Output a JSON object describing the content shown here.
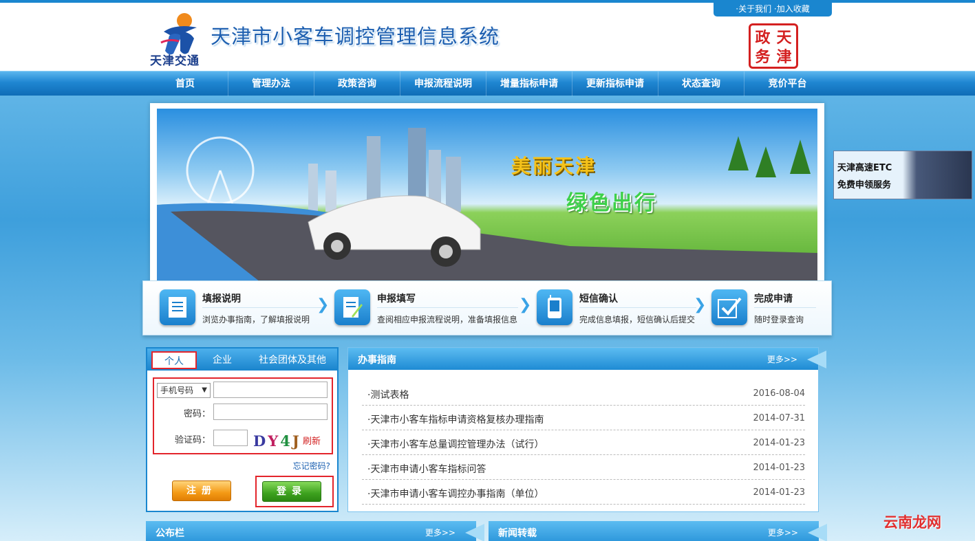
{
  "header": {
    "logo_text": "天津交通",
    "site_title": "天津市小客车调控管理信息系统",
    "top_links": [
      "·关于我们",
      "·加入收藏"
    ],
    "seal_chars": [
      "政",
      "天",
      "务",
      "津"
    ]
  },
  "nav": {
    "items": [
      "首页",
      "管理办法",
      "政策咨询",
      "申报流程说明",
      "增量指标申请",
      "更新指标申请",
      "状态查询",
      "竞价平台"
    ]
  },
  "banner": {
    "text1": "美丽天津",
    "text2": "绿色出行"
  },
  "steps": [
    {
      "title": "填报说明",
      "desc": "浏览办事指南，了解填报说明"
    },
    {
      "title": "申报填写",
      "desc": "查阅相应申报流程说明，准备填报信息"
    },
    {
      "title": "短信确认",
      "desc": "完成信息填报，短信确认后提交"
    },
    {
      "title": "完成申请",
      "desc": "随时登录查询"
    }
  ],
  "login": {
    "tabs": [
      "个人",
      "企业",
      "社会团体及其他"
    ],
    "id_type_selected": "手机号码",
    "id_value": "",
    "password_label": "密码：",
    "captcha_label": "验证码：",
    "captcha_value": "",
    "captcha_chars": [
      "D",
      "Y",
      "4",
      "J"
    ],
    "refresh_label": "刷新",
    "forgot_label": "忘记密码?",
    "register_label": "注册",
    "login_label": "登录"
  },
  "guide": {
    "title": "办事指南",
    "more": "更多>>",
    "items": [
      {
        "title": "·测试表格",
        "date": "2016-08-04"
      },
      {
        "title": "·天津市小客车指标申请资格复核办理指南",
        "date": "2014-07-31"
      },
      {
        "title": "·天津市小客车总量调控管理办法（试行）",
        "date": "2014-01-23"
      },
      {
        "title": "·天津市申请小客车指标问答",
        "date": "2014-01-23"
      },
      {
        "title": "·天津市申请小客车调控办事指南（单位）",
        "date": "2014-01-23"
      }
    ]
  },
  "bulletin": {
    "title": "公布栏",
    "more": "更多>>"
  },
  "news": {
    "title": "新闻转载",
    "more": "更多>>"
  },
  "etc_ad": {
    "line1": "天津高速ETC",
    "line2": "免费申领服务"
  },
  "watermark": "云南龙网",
  "colors": {
    "accent": "#1a86cf",
    "highlight_border": "#e3242b",
    "register": "#f49a15",
    "login": "#3da11e"
  }
}
